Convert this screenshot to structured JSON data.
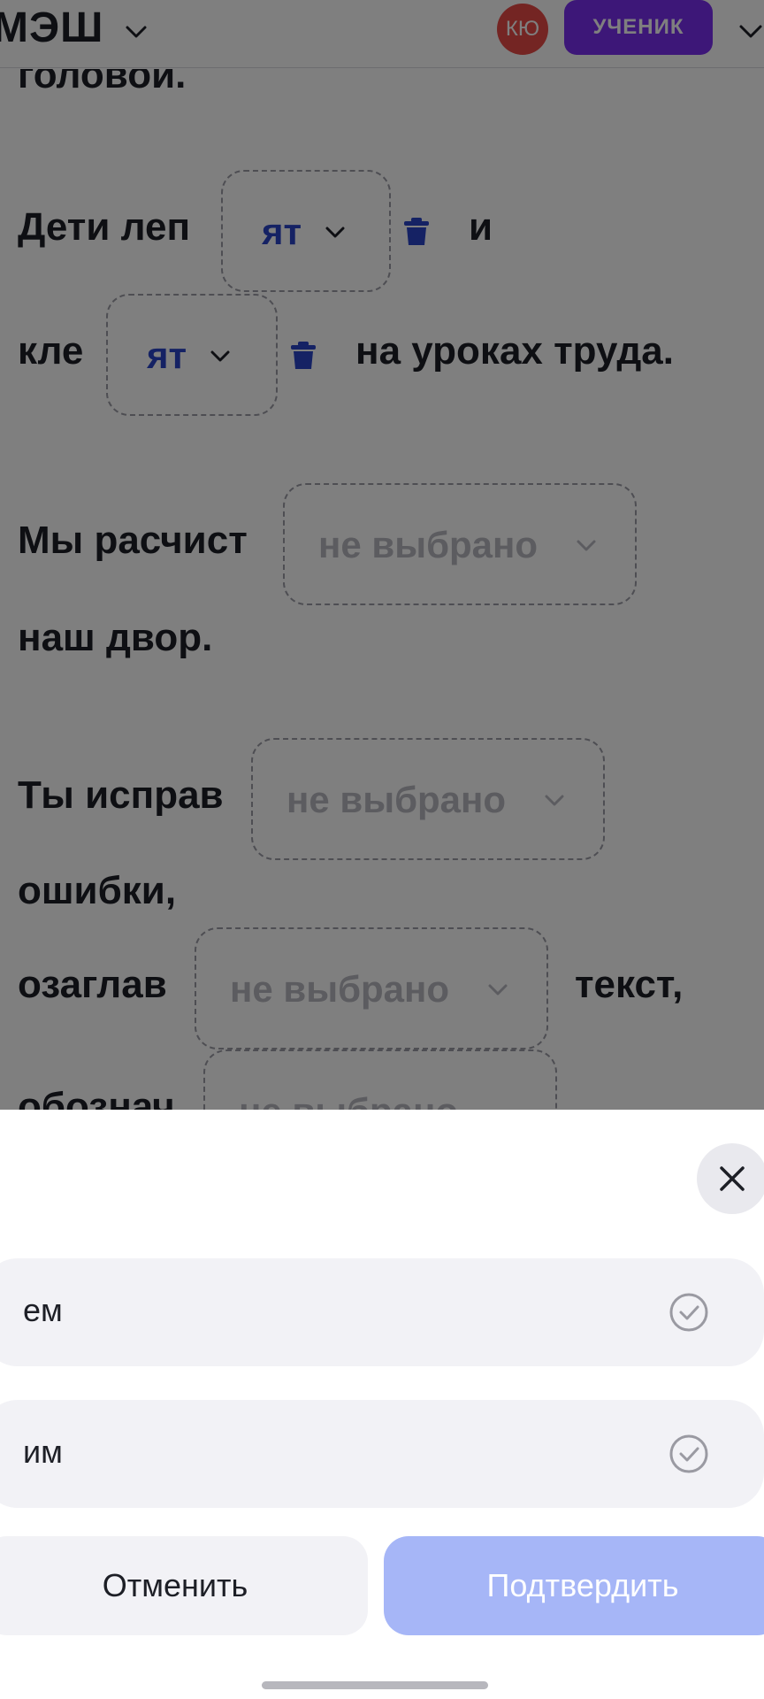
{
  "header": {
    "logo_text": "МЭШ",
    "avatar_initials": "КЮ",
    "role_label": "УЧЕНИК"
  },
  "exercise": {
    "fragment_top": "головой.",
    "s1_part1": "Дети леп",
    "s1_slot_value": "ят",
    "s1_part2": "и",
    "s2_part1": "кле",
    "s2_slot_value": "ят",
    "s2_part2": "на уроках труда.",
    "s3_part1": "Мы расчист",
    "s3_part2": "наш двор.",
    "s4_part1": "Ты исправ",
    "s4_part2": "ошибки,",
    "s5_part1": "озаглав",
    "s5_part2": "текст,",
    "s6_part1": "обознач",
    "slot_placeholder": "не выбрано"
  },
  "sheet": {
    "options": [
      {
        "label": "ем",
        "icon": "check-circle-icon"
      },
      {
        "label": "им",
        "icon": "check-circle-icon"
      }
    ],
    "cancel_label": "Отменить",
    "confirm_label": "Подтвердить"
  },
  "colors": {
    "accent": "#2a45c8",
    "role_badge": "#7b2ff0",
    "avatar": "#e84b47",
    "confirm_disabled": "#a6b6f7"
  }
}
